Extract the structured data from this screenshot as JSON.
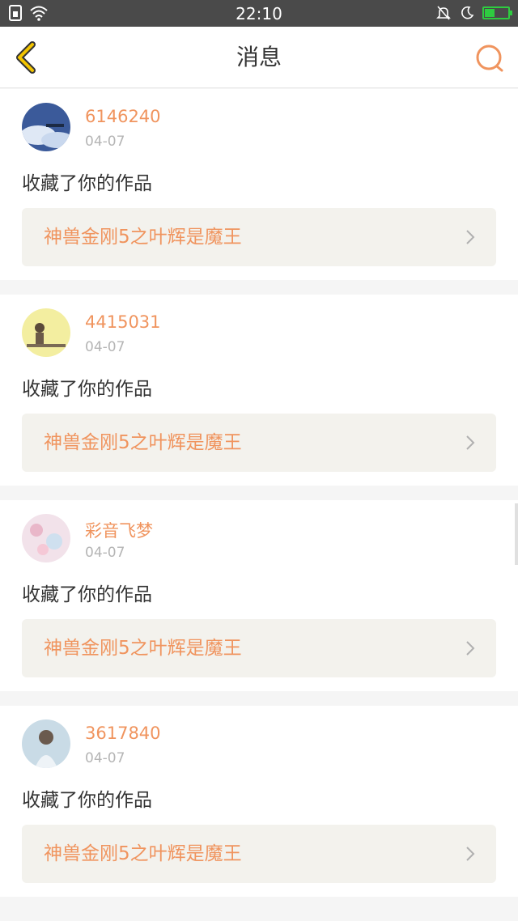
{
  "statusbar": {
    "time": "22:10",
    "battery_level": 0.4
  },
  "header": {
    "title": "消息"
  },
  "colors": {
    "accent": "#f0945e",
    "back": "#f2c400"
  },
  "messages": [
    {
      "username": "6146240",
      "date": "04-07",
      "action": "收藏了你的作品",
      "work_title": "神兽金刚5之叶辉是魔王"
    },
    {
      "username": "4415031",
      "date": "04-07",
      "action": "收藏了你的作品",
      "work_title": "神兽金刚5之叶辉是魔王"
    },
    {
      "username": "彩音飞梦",
      "date": "04-07",
      "action": "收藏了你的作品",
      "work_title": "神兽金刚5之叶辉是魔王"
    },
    {
      "username": "3617840",
      "date": "04-07",
      "action": "收藏了你的作品",
      "work_title": "神兽金刚5之叶辉是魔王"
    }
  ]
}
